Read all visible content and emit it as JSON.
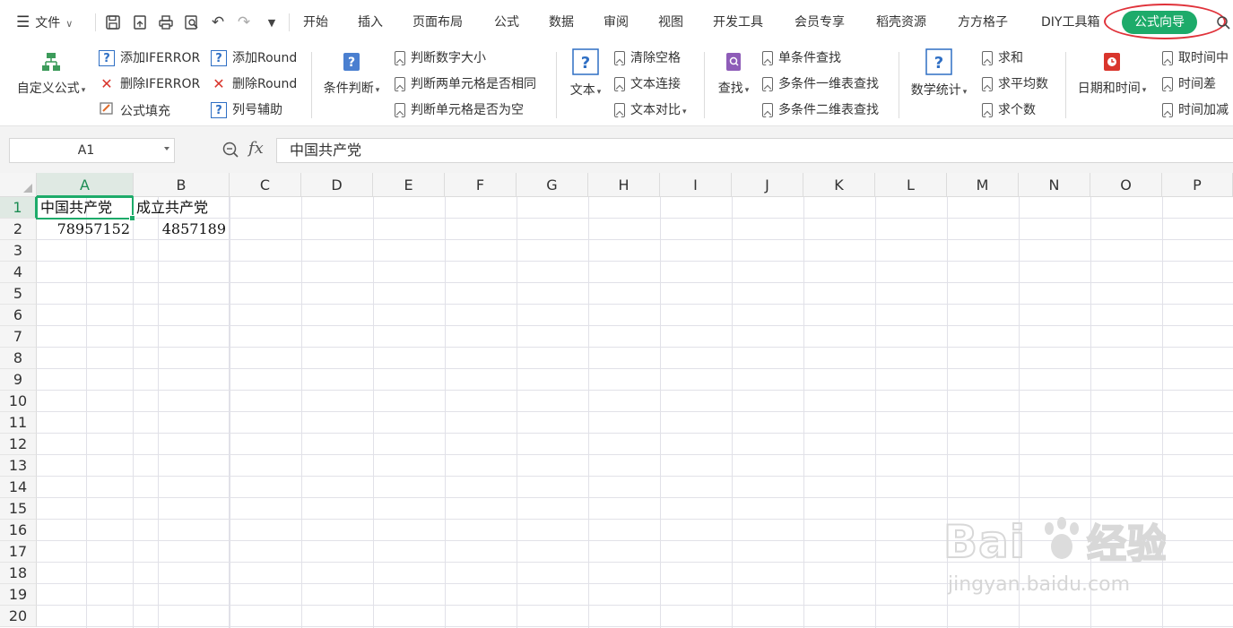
{
  "menubar": {
    "file": "文件",
    "tabs": [
      "开始",
      "插入",
      "页面布局",
      "公式",
      "数据",
      "审阅",
      "视图",
      "开发工具",
      "会员专享",
      "稻壳资源",
      "方方格子",
      "DIY工具箱"
    ],
    "active_tab": "公式向导"
  },
  "ribbon": {
    "custom_formula": "自定义公式",
    "add_iferror": "添加IFERROR",
    "del_iferror": "删除IFERROR",
    "formula_fill": "公式填充",
    "add_round": "添加Round",
    "del_round": "删除Round",
    "col_helper": "列号辅助",
    "condition": "条件判断",
    "judge_size": "判断数字大小",
    "judge_same": "判断两单元格是否相同",
    "judge_empty": "判断单元格是否为空",
    "text": "文本",
    "clear_space": "清除空格",
    "text_join": "文本连接",
    "text_compare": "文本对比",
    "find": "查找",
    "find_single": "单条件查找",
    "find_multi1": "多条件一维表查找",
    "find_multi2": "多条件二维表查找",
    "math_stat": "数学统计",
    "sum": "求和",
    "average": "求平均数",
    "count": "求个数",
    "date_time": "日期和时间",
    "get_time": "取时间中",
    "time_diff": "时间差",
    "time_add": "时间加减"
  },
  "formula_bar": {
    "name_box": "A1",
    "fx": "fx",
    "content": "中国共产党"
  },
  "sheet": {
    "columns": [
      "A",
      "B",
      "C",
      "D",
      "E",
      "F",
      "G",
      "H",
      "I",
      "J",
      "K",
      "L",
      "M",
      "N",
      "O",
      "P"
    ],
    "rows": [
      "1",
      "2",
      "3",
      "4",
      "5",
      "6",
      "7",
      "8",
      "9",
      "10",
      "11",
      "12",
      "13",
      "14",
      "15",
      "16",
      "17",
      "18",
      "19",
      "20"
    ],
    "a1": "中国共产党",
    "b1": "成立共产党",
    "a2": "78957152",
    "b2": "4857189"
  },
  "watermark": {
    "logo": "Bai du 经验",
    "url": "jingyan.baidu.com"
  }
}
